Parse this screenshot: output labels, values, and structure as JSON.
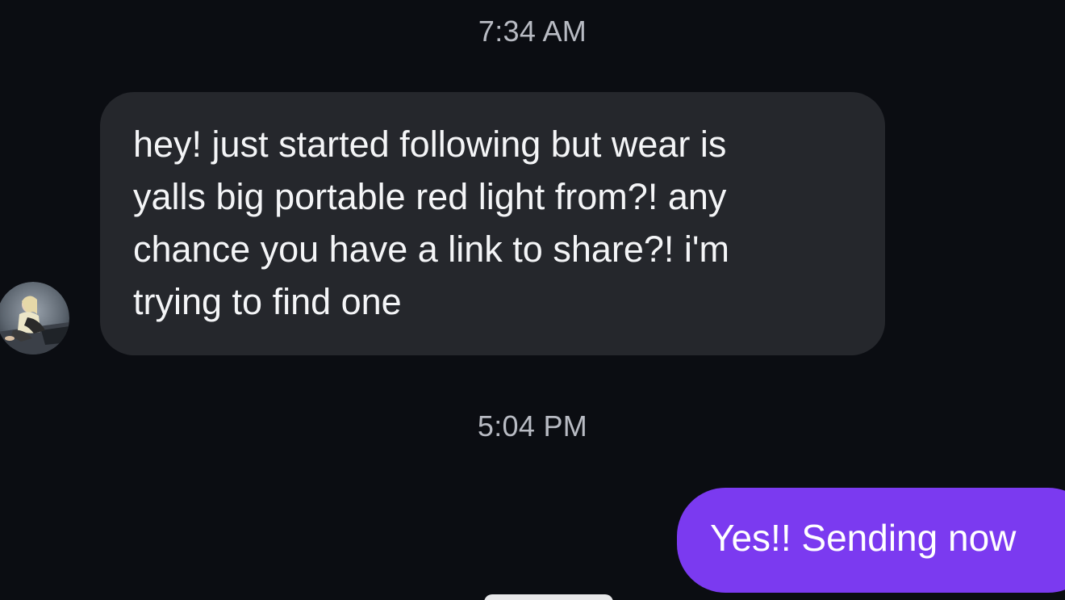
{
  "conversation": {
    "timestamps": [
      "7:34 AM",
      "5:04 PM"
    ],
    "messages": [
      {
        "direction": "incoming",
        "lines": [
          "hey! just started following but wear is",
          "yalls big portable red light from?! any",
          "chance you have a link to share?! i'm",
          "trying to find one"
        ]
      },
      {
        "direction": "outgoing",
        "text": "Yes!! Sending now"
      }
    ]
  },
  "colors": {
    "background": "#0b0d12",
    "incoming_bubble": "#25272c",
    "outgoing_bubble": "#7b3af0",
    "timestamp_text": "#b8bbc3"
  },
  "icons": {
    "sender_avatar": "avatar-photo"
  }
}
